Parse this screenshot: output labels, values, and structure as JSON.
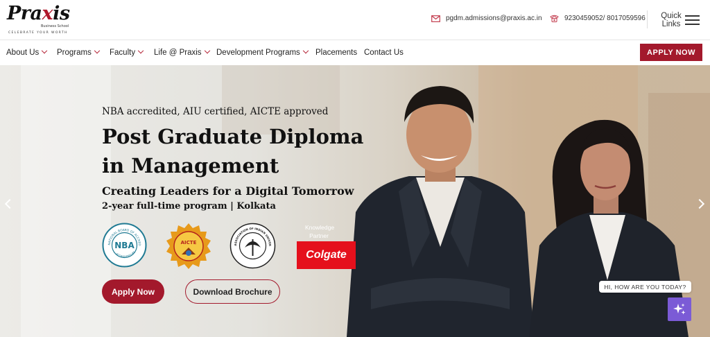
{
  "brand": {
    "logo_word_1": "Pra",
    "logo_word_x": "x",
    "logo_word_2": "is",
    "logo_sub": "Business School",
    "logo_tagline": "CELEBRATE YOUR WORTH",
    "accent": "#a3192c"
  },
  "header": {
    "email": "pgdm.admissions@praxis.ac.in",
    "phone": "9230459052/ 8017059596",
    "quick_links_1": "Quick",
    "quick_links_2": "Links",
    "email_icon": "mail-icon",
    "phone_icon": "phone-icon",
    "menu_icon": "hamburger-icon"
  },
  "nav": {
    "items": [
      {
        "label": "About Us"
      },
      {
        "label": "Programs"
      },
      {
        "label": "Faculty"
      },
      {
        "label": "Life @ Praxis"
      },
      {
        "label": "Development Programs"
      },
      {
        "label": "Placements"
      },
      {
        "label": "Contact Us"
      }
    ],
    "apply_label": "APPLY NOW"
  },
  "hero": {
    "kicker": "NBA accredited, AIU certified, AICTE approved",
    "title_line1": "Post Graduate Diploma",
    "title_line2": "in Management",
    "subtitle": "Creating Leaders for a Digital Tomorrow",
    "program": "2-year full-time program | Kolkata",
    "badges": {
      "nba_text": "NBA",
      "nba_ring": "NATIONAL BOARD OF ACCREDITATION",
      "nba_ring_2": "ACCREDITED BY",
      "aicte_text": "AICTE",
      "aiu_ring": "ASSOCIATION OF INDIAN UNIVERSITIES"
    },
    "knowledge_partner_1": "Knowledge",
    "knowledge_partner_2": "Partner",
    "partner_name": "Colgate",
    "apply_button": "Apply Now",
    "brochure_button": "Download Brochure"
  },
  "chat": {
    "greeting": "HI, HOW ARE YOU TODAY?",
    "icon": "sparkle-icon",
    "color": "#7b5bd6"
  },
  "carousel": {
    "prev_icon": "chevron-left-icon",
    "next_icon": "chevron-right-icon"
  }
}
